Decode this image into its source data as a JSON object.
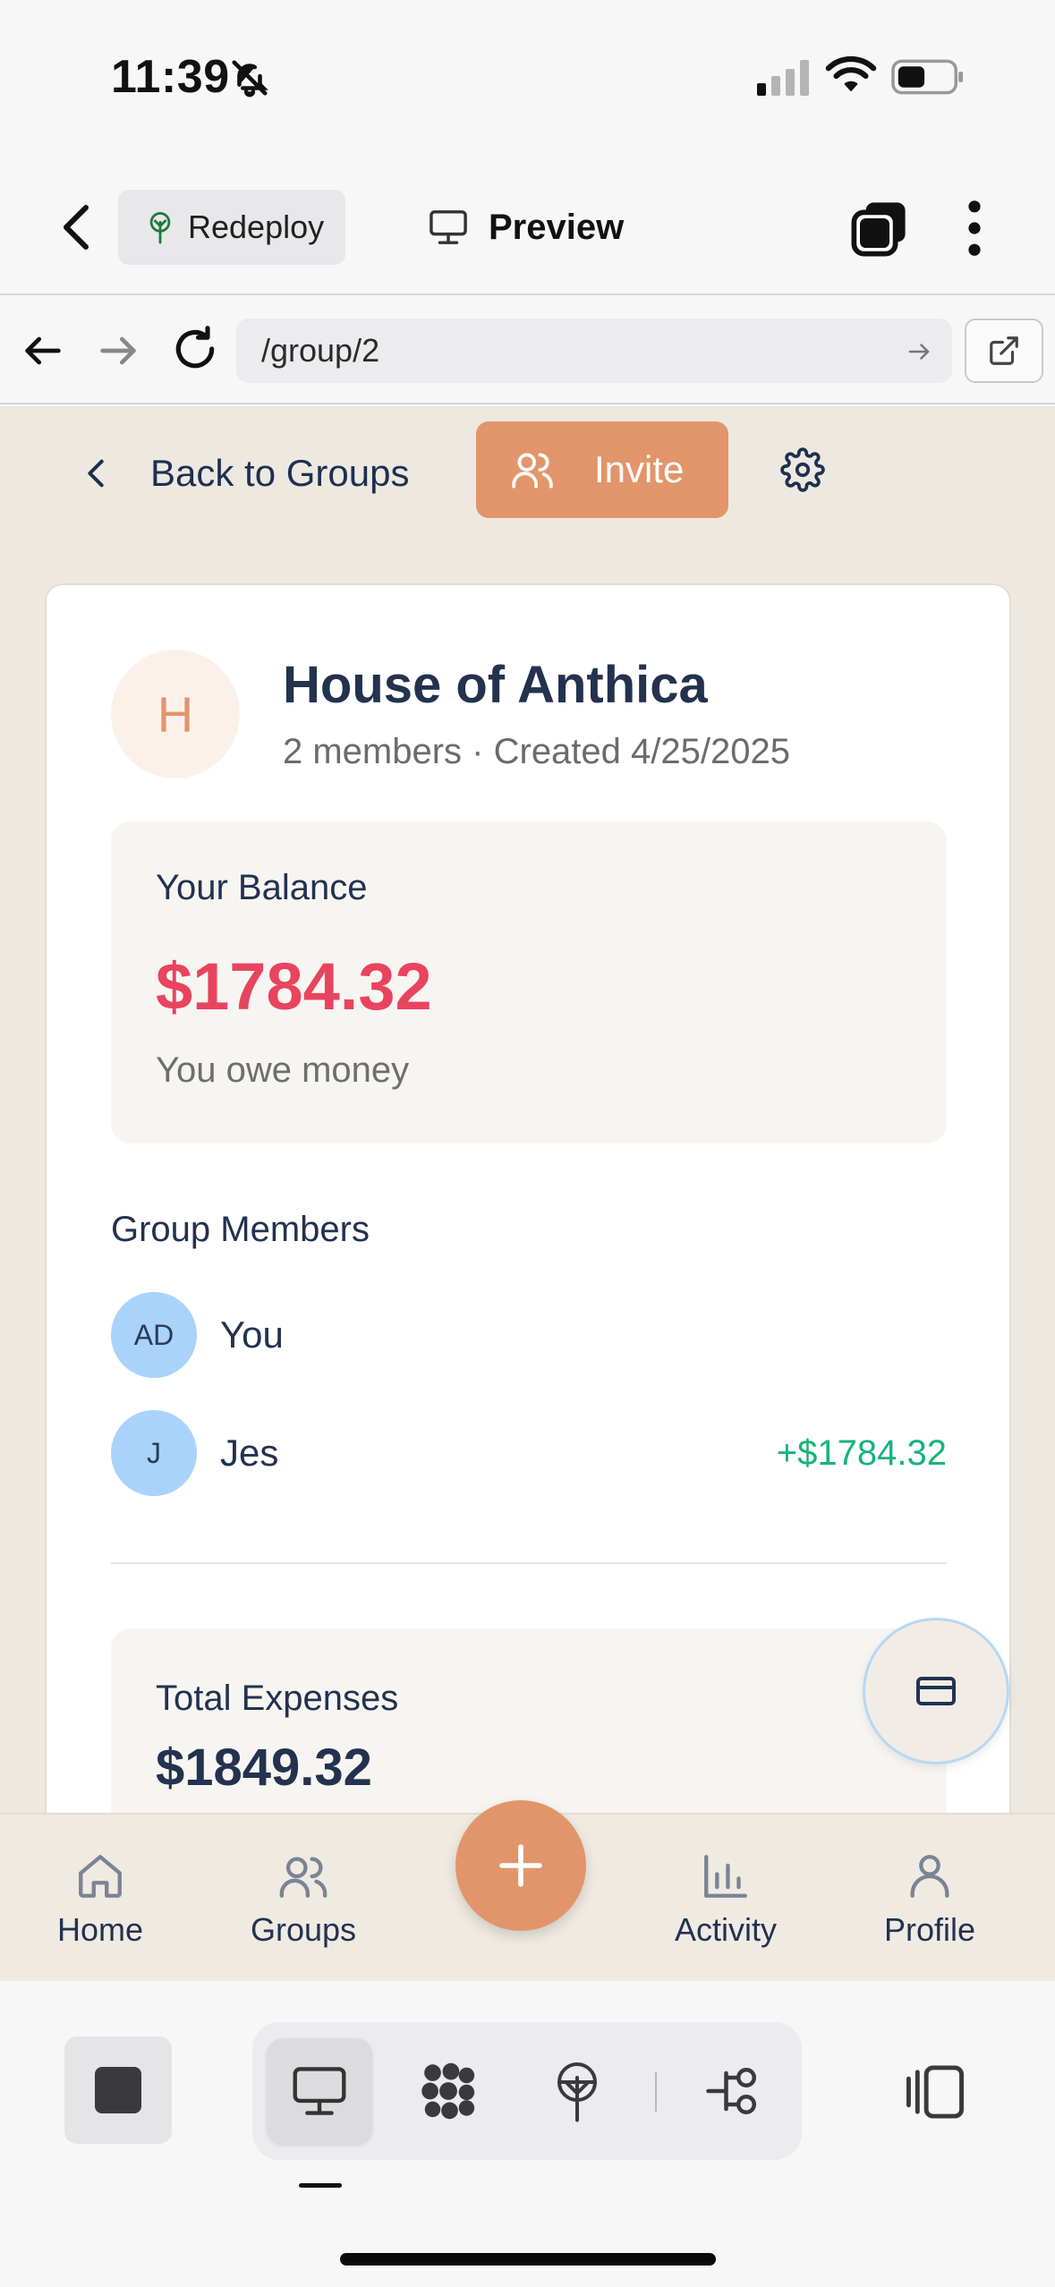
{
  "status_bar": {
    "time": "11:39"
  },
  "app_header": {
    "redeploy_label": "Redeploy",
    "preview_label": "Preview"
  },
  "url_bar": {
    "url": "/group/2"
  },
  "page_nav": {
    "back_label": "Back to Groups",
    "invite_label": "Invite"
  },
  "group": {
    "initial": "H",
    "name": "House of Anthica",
    "meta": "2 members · Created 4/25/2025"
  },
  "balance": {
    "label": "Your Balance",
    "value": "$1784.32",
    "note": "You owe money",
    "value_color": "#e8445f"
  },
  "members": {
    "title": "Group Members",
    "items": [
      {
        "initials": "AD",
        "name": "You",
        "amount": ""
      },
      {
        "initials": "J",
        "name": "Jes",
        "amount": "+$1784.32"
      }
    ]
  },
  "expenses": {
    "label": "Total Expenses",
    "value": "$1849.32"
  },
  "bottom_nav": {
    "items": [
      {
        "label": "Home",
        "icon": "home-icon"
      },
      {
        "label": "Groups",
        "icon": "users-icon"
      },
      {
        "label": "Activity",
        "icon": "bar-chart-icon"
      },
      {
        "label": "Profile",
        "icon": "user-icon"
      }
    ]
  },
  "colors": {
    "accent": "#e2956b",
    "page_bg": "#ede9e1",
    "heading": "#22324f",
    "positive": "#16b47a",
    "negative": "#e8445f",
    "avatar_bg": "#a9d3fb"
  }
}
